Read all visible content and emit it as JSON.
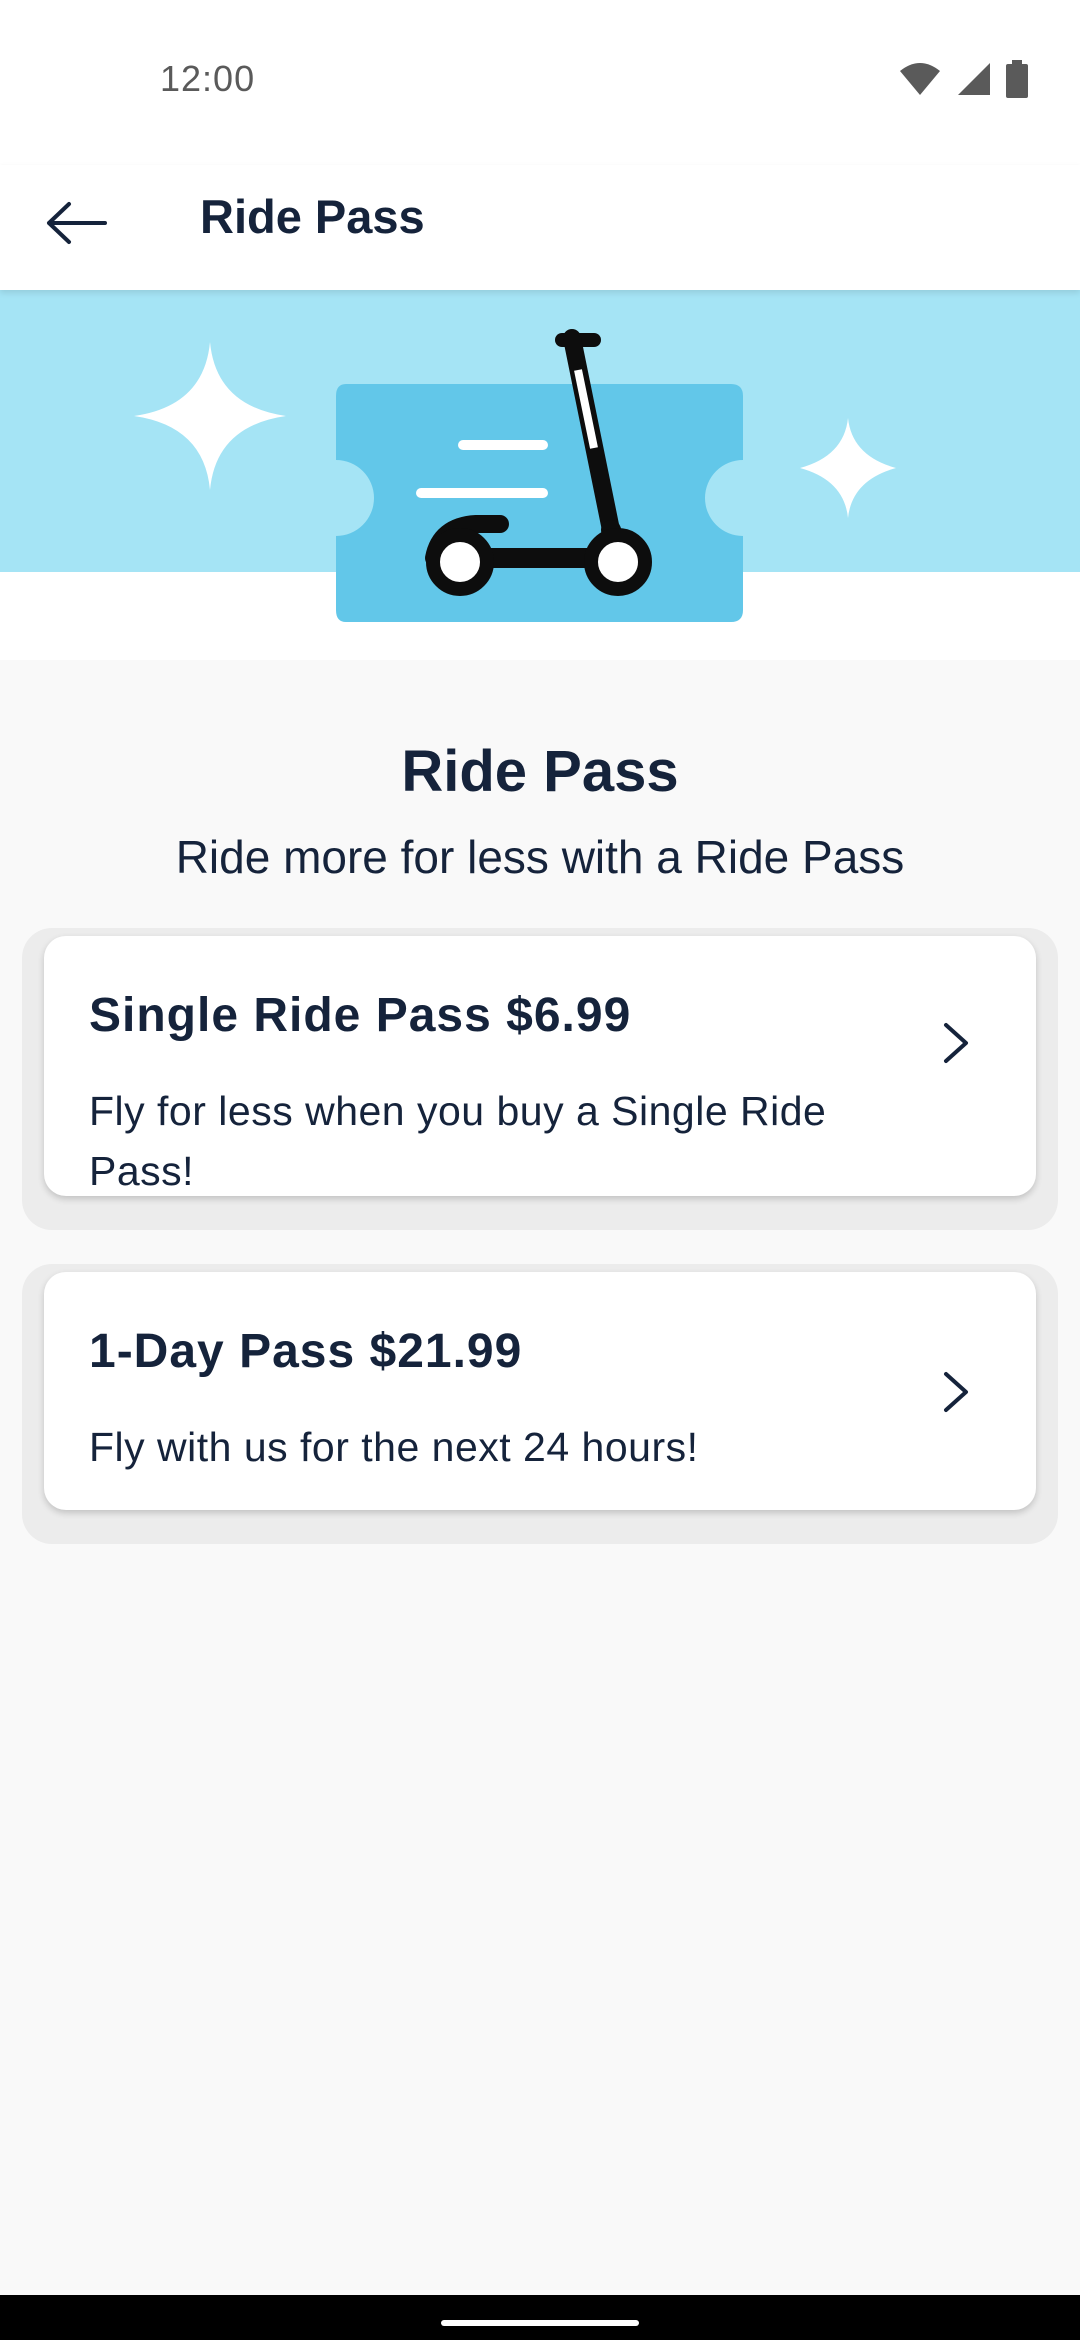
{
  "status_bar": {
    "time": "12:00",
    "icons": [
      "wifi-icon",
      "cellular-signal-icon",
      "battery-icon"
    ]
  },
  "app_bar": {
    "back_icon": "arrow-left-icon",
    "title": "Ride Pass"
  },
  "hero": {
    "illustration": "scooter-ticket-illustration",
    "colors": {
      "band": "#a5e4f5",
      "ticket": "#62c7e9",
      "scooter": "#0d0d0d",
      "sparkle": "#ffffff"
    }
  },
  "main": {
    "title": "Ride Pass",
    "subtitle": "Ride more for less with a Ride Pass",
    "passes": [
      {
        "title": "Single Ride Pass $6.99",
        "description": "Fly for less when you buy a Single Ride Pass!",
        "icon": "chevron-right-icon"
      },
      {
        "title": "1-Day Pass $21.99",
        "description": "Fly with us for the next 24 hours!",
        "icon": "chevron-right-icon"
      }
    ]
  },
  "colors": {
    "text_primary": "#15233b",
    "background": "#f9f9f9",
    "card": "#ffffff"
  }
}
